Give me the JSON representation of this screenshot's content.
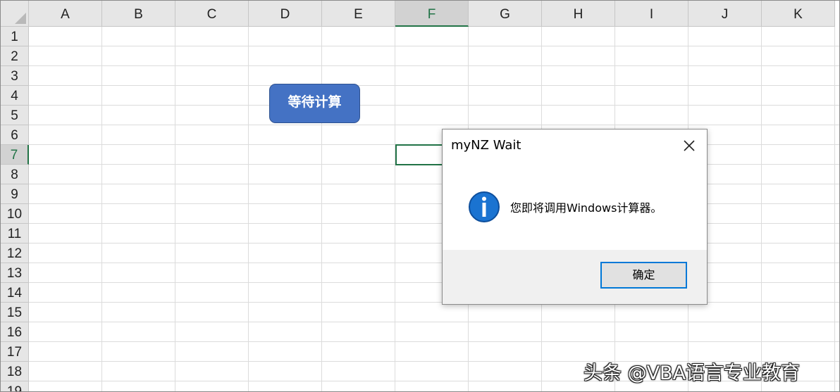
{
  "sheet": {
    "columns": [
      "A",
      "B",
      "C",
      "D",
      "E",
      "F",
      "G",
      "H",
      "I",
      "J",
      "K"
    ],
    "rows": [
      "1",
      "2",
      "3",
      "4",
      "5",
      "6",
      "7",
      "8",
      "9",
      "10",
      "11",
      "12",
      "13",
      "14",
      "15",
      "16",
      "17",
      "18",
      "19"
    ],
    "selected_column": "F",
    "selected_row": "7"
  },
  "shape_button": {
    "label": "等待计算",
    "fill_color": "#4472c4"
  },
  "dialog": {
    "title": "myNZ Wait",
    "icon": "info-icon",
    "message": "您即将调用Windows计算器。",
    "ok_label": "确定",
    "accent_color": "#0078d7"
  },
  "watermark": {
    "text": "头条 @VBA语言专业教育"
  }
}
